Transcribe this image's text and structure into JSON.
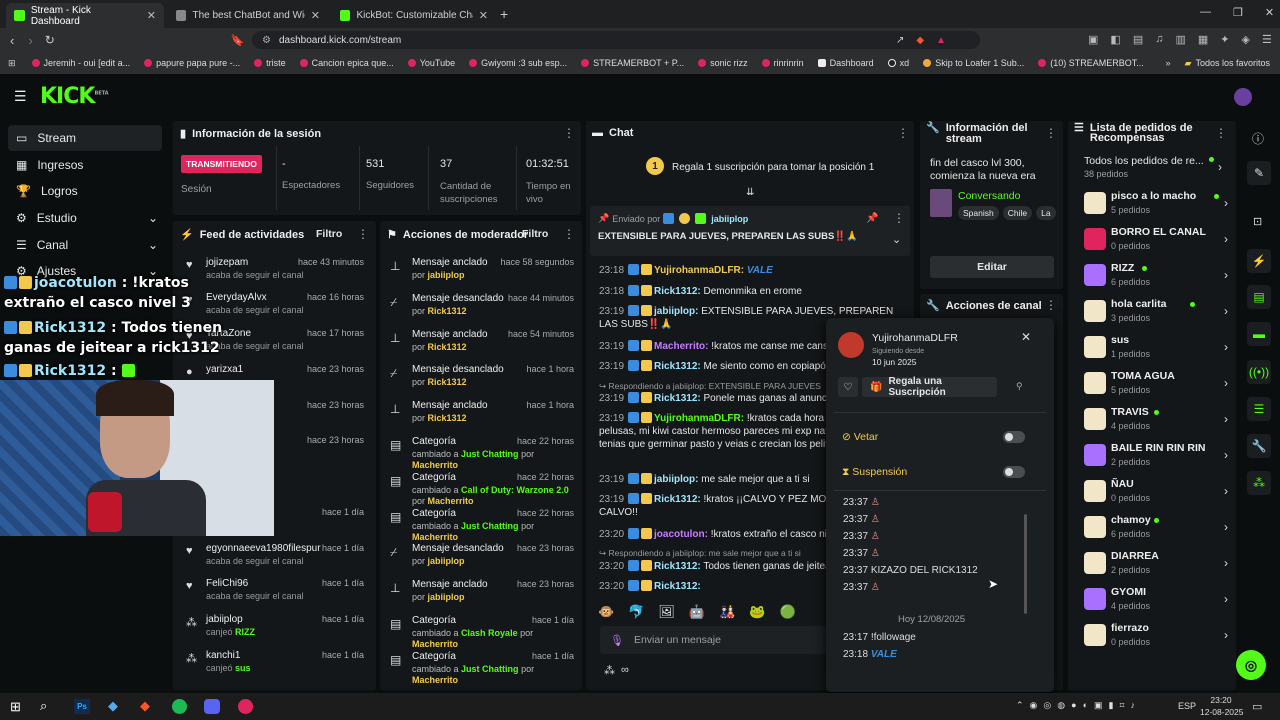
{
  "browser": {
    "tabs": [
      {
        "label": "Stream - Kick Dashboard",
        "active": true
      },
      {
        "label": "The best ChatBot and Widgets fo"
      },
      {
        "label": "KickBot: Customizable Chat Bot for K"
      }
    ],
    "url": "dashboard.kick.com/stream",
    "bookmarks": [
      "Jeremih - oui [edit a...",
      "papure papa pure -...",
      "triste",
      "Cancion epica que...",
      "YouTube",
      "Gwiyomi :3 sub esp...",
      "STREAMERBOT + P...",
      "sonic rizz",
      "rinrinrin",
      "Dashboard",
      "xd",
      "Skip to Loafer 1 Sub...",
      "(10) STREAMERBOT..."
    ],
    "all_favorites": "Todos los favoritos"
  },
  "kick": {
    "logo": "KICK",
    "logo_sup": "BETA"
  },
  "sidebar": {
    "items": [
      {
        "label": "Stream"
      },
      {
        "label": "Ingresos"
      },
      {
        "label": "Logros"
      },
      {
        "label": "Estudio"
      },
      {
        "label": "Canal"
      },
      {
        "label": "Ajustes"
      }
    ]
  },
  "session": {
    "title": "Información de la sesión",
    "status": "TRANSMITIENDO",
    "status_label": "Sesión",
    "stats": [
      {
        "value": "-",
        "label": "Espectadores"
      },
      {
        "value": "531",
        "label": "Seguidores"
      },
      {
        "value": "37",
        "label": "Cantidad de suscripciones"
      },
      {
        "value": "01:32:51",
        "label": "Tiempo en vivo"
      }
    ]
  },
  "activity": {
    "title": "Feed de actividades",
    "filter": "Filtro",
    "items": [
      {
        "name": "jojizepam",
        "time": "hace 43 minutos",
        "sub": "acaba de seguir el canal"
      },
      {
        "name": "EverydayAlvx",
        "time": "hace 16 horas",
        "sub": "acaba de seguir el canal"
      },
      {
        "name": "TartaZone",
        "time": "hace 17 horas",
        "sub": "acaba de seguir el canal"
      },
      {
        "name": "yarizxa1",
        "time": "hace 23 horas",
        "sub": ""
      },
      {
        "name": "",
        "time": "hace 23 horas",
        "sub": ""
      },
      {
        "name": "",
        "time": "hace 23 horas",
        "sub": ""
      },
      {
        "name": "",
        "time": "hace 1 día",
        "sub": "canal"
      },
      {
        "name": "egyonnaeeva1980filespur",
        "time": "hace 1 día",
        "sub": "acaba de seguir el canal"
      },
      {
        "name": "FeliChi96",
        "time": "hace 1 día",
        "sub": "acaba de seguir el canal"
      },
      {
        "name": "jabiiplop",
        "time": "hace 1 día",
        "sub": "canjeó",
        "reward": "RIZZ"
      },
      {
        "name": "kanchi1",
        "time": "hace 1 día",
        "sub": "canjeó",
        "reward": "sus"
      }
    ]
  },
  "mod": {
    "title": "Acciones de moderador",
    "filter": "Filtro",
    "items": [
      {
        "name": "Mensaje anclado",
        "time": "hace 58 segundos",
        "pre": "por",
        "by": "jabiiplop"
      },
      {
        "name": "Mensaje desanclado",
        "time": "hace 44 minutos",
        "pre": "por",
        "by": "Rick1312"
      },
      {
        "name": "Mensaje anclado",
        "time": "hace 54 minutos",
        "pre": "por",
        "by": "Rick1312"
      },
      {
        "name": "Mensaje desanclado",
        "time": "hace 1 hora",
        "pre": "por",
        "by": "Rick1312"
      },
      {
        "name": "Mensaje anclado",
        "time": "hace 1 hora",
        "pre": "por",
        "by": "Rick1312"
      },
      {
        "name": "Categoría",
        "time": "hace 22 horas",
        "pre": "cambiado a",
        "cat": "Just Chatting",
        "by": "Macherrito"
      },
      {
        "name": "Categoría",
        "time": "hace 22 horas",
        "pre": "cambiado a",
        "cat": "Call of Duty: Warzone 2.0",
        "by": "Macherrito"
      },
      {
        "name": "Categoría",
        "time": "hace 22 horas",
        "pre": "cambiado a",
        "cat": "Just Chatting",
        "by": "Macherrito"
      },
      {
        "name": "Mensaje desanclado",
        "time": "hace 23 horas",
        "pre": "por",
        "by": "jabiiplop"
      },
      {
        "name": "Mensaje anclado",
        "time": "hace 23 horas",
        "pre": "por",
        "by": "jabiiplop"
      },
      {
        "name": "Categoría",
        "time": "hace 1 día",
        "pre": "cambiado a",
        "cat": "Clash Royale",
        "by": "Macherrito"
      },
      {
        "name": "Categoría",
        "time": "hace 1 día",
        "pre": "cambiado a",
        "cat": "Just Chatting",
        "by": "Macherrito"
      }
    ],
    "por": "por"
  },
  "chat": {
    "title": "Chat",
    "gift_banner": "Regala 1 suscripción para tomar la posición 1",
    "pinned_by_label": "Enviado por",
    "pinned_by": "jabiiplop",
    "pinned_text": "EXTENSIBLE PARA JUEVES, PREPAREN LAS SUBS‼️🙏",
    "messages": [
      {
        "time": "23:18",
        "user": "YujirohanmaDLFR:",
        "text": "VALE",
        "ucolor": "#f2c94c"
      },
      {
        "time": "23:18",
        "user": "Rick1312:",
        "text": "Demonmika en erome",
        "ucolor": "#9fe6ff"
      },
      {
        "time": "23:19",
        "user": "jabiiplop:",
        "text": "EXTENSIBLE PARA JUEVES, PREPAREN LAS SUBS‼️🙏",
        "ucolor": "#9fe6ff"
      },
      {
        "time": "23:19",
        "user": "Macherrito:",
        "text": "!kratos me canse me canse",
        "ucolor": "#c77dff"
      },
      {
        "time": "23:19",
        "user": "Rick1312:",
        "text": "Me siento como en copiapó",
        "ucolor": "#9fe6ff"
      },
      {
        "reply": "Respondiendo a jabiiplop: EXTENSIBLE PARA JUEVES"
      },
      {
        "time": "23:19",
        "user": "Rick1312:",
        "text": "Ponele mas ganas al anuncio",
        "ucolor": "#9fe6ff"
      },
      {
        "time": "23:19",
        "user": "YujirohanmaDLFR:",
        "text": "!kratos cada hora que entro mas pelusas, mi kiwi castor hermoso pareces mi exp naturales cuando tenias que germinar pasto y veias c crecian los pelitos",
        "ucolor": "#53fc18"
      },
      {
        "time": "23:19",
        "user": "jabiiplop:",
        "text": "me sale mejor que a ti si",
        "ucolor": "#9fe6ff"
      },
      {
        "time": "23:19",
        "user": "Rick1312:",
        "text": "!kratos ¡¡CALVO Y PEZ MOCO!! PUTO CALVO!!",
        "ucolor": "#9fe6ff"
      },
      {
        "time": "23:20",
        "user": "joacotulon:",
        "text": "!kratos extraño el casco nivel 3",
        "ucolor": "#c77dff"
      },
      {
        "reply": "Respondiendo a jabiiplop: me sale mejor que a ti si"
      },
      {
        "time": "23:20",
        "user": "Rick1312:",
        "text": "Todos tienen ganas de jeitear",
        "ucolor": "#9fe6ff"
      },
      {
        "time": "23:20",
        "user": "Rick1312:",
        "text": "",
        "ucolor": "#9fe6ff"
      }
    ],
    "input_placeholder": "Enviar un mensaje"
  },
  "stream_info": {
    "title": "Información del stream",
    "stream_title": "fin del casco lvl 300, comienza la nueva era",
    "category": "Conversando",
    "tags": [
      "Spanish",
      "Chile",
      "La"
    ],
    "edit_label": "Editar",
    "channel_actions": "Acciones de canal"
  },
  "user_popup": {
    "username": "YujirohanmaDLFR",
    "following_label": "Siguiendo desde",
    "following_date": "10 jun 2025",
    "gift_label": "Regala una Suscripción",
    "veto_label": "Vetar",
    "suspend_label": "Suspensión",
    "history": [
      {
        "time": "23:37",
        "text": ""
      },
      {
        "time": "23:37",
        "text": ""
      },
      {
        "time": "23:37",
        "text": ""
      },
      {
        "time": "23:37",
        "text": ""
      },
      {
        "time": "23:37",
        "text": "KIZAZO DEL RICK1312"
      },
      {
        "time": "23:37",
        "text": ""
      }
    ],
    "day_divider": "Hoy 12/08/2025",
    "recent": [
      {
        "time": "23:17",
        "text": "!followage"
      },
      {
        "time": "23:18",
        "text": "VALE"
      }
    ]
  },
  "rewards": {
    "title": "Lista de pedidos de Recompensas",
    "all_label": "Todos los pedidos de re...",
    "all_count": "38 pedidos",
    "items": [
      {
        "name": "pisco a lo macho",
        "count": "5 pedidos",
        "color": "#f2e6c9",
        "active": true
      },
      {
        "name": "BORRO EL CANAL",
        "count": "0 pedidos",
        "color": "#e0245e"
      },
      {
        "name": "RIZZ",
        "count": "6 pedidos",
        "color": "#a970ff",
        "active": true
      },
      {
        "name": "hola carlita",
        "count": "3 pedidos",
        "color": "#f2e6c9",
        "active": true
      },
      {
        "name": "sus",
        "count": "1 pedidos",
        "color": "#f2e6c9"
      },
      {
        "name": "TOMA AGUA",
        "count": "5 pedidos",
        "color": "#f2e6c9"
      },
      {
        "name": "TRAVIS",
        "count": "4 pedidos",
        "color": "#f2e6c9",
        "active": true
      },
      {
        "name": "BAILE RIN RIN RIN",
        "count": "2 pedidos",
        "color": "#a970ff"
      },
      {
        "name": "ÑAU",
        "count": "0 pedidos",
        "color": "#f2e6c9"
      },
      {
        "name": "chamoy",
        "count": "6 pedidos",
        "color": "#f2e6c9",
        "active": true
      },
      {
        "name": "DIARREA",
        "count": "2 pedidos",
        "color": "#f2e6c9"
      },
      {
        "name": "GYOMI",
        "count": "4 pedidos",
        "color": "#a970ff"
      },
      {
        "name": "fierrazo",
        "count": "0 pedidos",
        "color": "#f2e6c9"
      }
    ]
  },
  "overlay": {
    "lines": [
      {
        "user": "joacotulon",
        "text": " : !kratos extraño el casco nivel 3"
      },
      {
        "user": "Rick1312",
        "text": " : Todos tienen ganas de jeitear a rick1312"
      },
      {
        "user": "Rick1312",
        "text": " : "
      }
    ]
  },
  "taskbar": {
    "lang": "ESP",
    "time": "23:20",
    "date": "12-08-2025"
  },
  "colors": {
    "accent": "#53fc18",
    "live": "#e0245e",
    "panel": "#141719"
  }
}
